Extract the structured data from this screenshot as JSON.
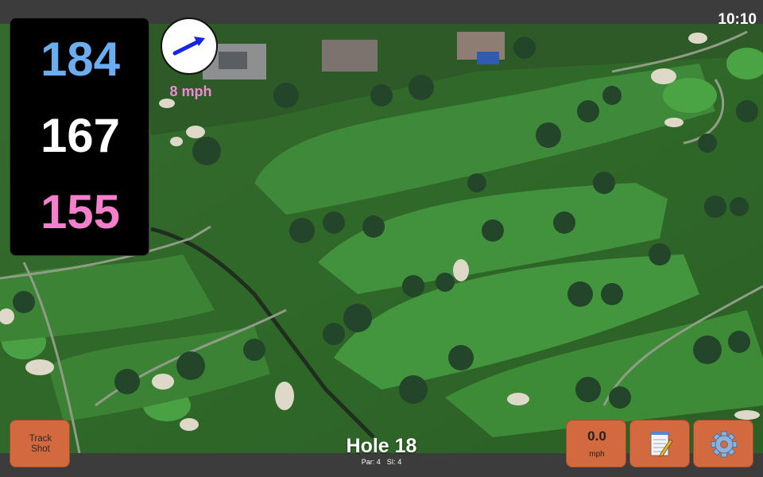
{
  "status": {
    "time": "10:10"
  },
  "distances": {
    "back": "184",
    "middle": "167",
    "front": "155"
  },
  "wind": {
    "speed_label": "8 mph",
    "icon": "wind-direction-arrow-icon"
  },
  "hole": {
    "title": "Hole 18",
    "par": "Par: 4",
    "si": "SI: 4"
  },
  "buttons": {
    "track_shot": {
      "line1": "Track",
      "line2": "Shot"
    },
    "speed": {
      "value": "0.0",
      "unit": "mph"
    },
    "notes_icon": "notepad-icon",
    "settings_icon": "gear-icon"
  },
  "colors": {
    "back": "#6aaef0",
    "middle": "#ffffff",
    "front": "#f47fcb",
    "wind_text": "#f08ad6",
    "button_bg": "#d3693e",
    "arrow": "#1426e0"
  }
}
